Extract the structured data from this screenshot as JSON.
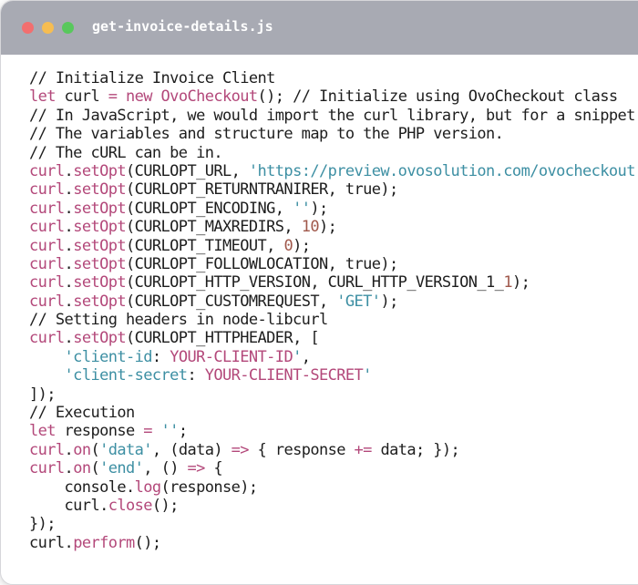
{
  "window": {
    "title": "get-invoice-details.js"
  },
  "colors": {
    "titlebar": "#a8aab3",
    "close_dot": "#f26f6f",
    "minimize_dot": "#f6bd52",
    "maximize_dot": "#58c85c",
    "default_text": "#1d1d1d",
    "keyword": "#b3487a",
    "member": "#b3487a",
    "string": "#3d8fa3",
    "number": "#a0584b",
    "comment": "#1d1d1d"
  },
  "code": {
    "lines": [
      [
        {
          "t": "// Initialize Invoice Client",
          "k": "default"
        }
      ],
      [
        {
          "t": "let",
          "k": "keyword"
        },
        {
          "t": " curl ",
          "k": "default"
        },
        {
          "t": "=",
          "k": "keyword"
        },
        {
          "t": " ",
          "k": "default"
        },
        {
          "t": "new",
          "k": "keyword"
        },
        {
          "t": " ",
          "k": "default"
        },
        {
          "t": "OvoCheckout",
          "k": "member"
        },
        {
          "t": "(); // Initialize using OvoCheckout class",
          "k": "default"
        }
      ],
      [
        {
          "t": "// In JavaScript, we would import the curl library, but for a snippet",
          "k": "default"
        }
      ],
      [
        {
          "t": "// The variables and structure map to the PHP version.",
          "k": "default"
        }
      ],
      [
        {
          "t": "// The cURL can be in.",
          "k": "default"
        }
      ],
      [
        {
          "t": "curl",
          "k": "member"
        },
        {
          "t": ".",
          "k": "default"
        },
        {
          "t": "setOpt",
          "k": "member"
        },
        {
          "t": "(CURLOPT_URL, ",
          "k": "default"
        },
        {
          "t": "'https://preview.ovosolution.com/ovocheckout'",
          "k": "string"
        }
      ],
      [
        {
          "t": "curl",
          "k": "member"
        },
        {
          "t": ".",
          "k": "default"
        },
        {
          "t": "setOpt",
          "k": "member"
        },
        {
          "t": "(CURLOPT_RETURNTRANIRER, true);",
          "k": "default"
        }
      ],
      [
        {
          "t": "curl",
          "k": "member"
        },
        {
          "t": ".",
          "k": "default"
        },
        {
          "t": "setOpt",
          "k": "member"
        },
        {
          "t": "(CURLOPT_ENCODING, ",
          "k": "default"
        },
        {
          "t": "''",
          "k": "string"
        },
        {
          "t": ");",
          "k": "default"
        }
      ],
      [
        {
          "t": "curl",
          "k": "member"
        },
        {
          "t": ".",
          "k": "default"
        },
        {
          "t": "setOpt",
          "k": "member"
        },
        {
          "t": "(CURLOPT_MAXREDIRS, ",
          "k": "default"
        },
        {
          "t": "10",
          "k": "number"
        },
        {
          "t": ");",
          "k": "default"
        }
      ],
      [
        {
          "t": "curl",
          "k": "member"
        },
        {
          "t": ".",
          "k": "default"
        },
        {
          "t": "setOpt",
          "k": "member"
        },
        {
          "t": "(CURLOPT_TIMEOUT, ",
          "k": "default"
        },
        {
          "t": "0",
          "k": "number"
        },
        {
          "t": ");",
          "k": "default"
        }
      ],
      [
        {
          "t": "curl",
          "k": "member"
        },
        {
          "t": ".",
          "k": "default"
        },
        {
          "t": "setOpt",
          "k": "member"
        },
        {
          "t": "(CURLOPT_FOLLOWLOCATION, true);",
          "k": "default"
        }
      ],
      [
        {
          "t": "curl",
          "k": "member"
        },
        {
          "t": ".",
          "k": "default"
        },
        {
          "t": "setOpt",
          "k": "member"
        },
        {
          "t": "(CURLOPT_HTTP_VERSION, CURL_HTTP_VERSION_1_",
          "k": "default"
        },
        {
          "t": "1",
          "k": "number"
        },
        {
          "t": ");",
          "k": "default"
        }
      ],
      [
        {
          "t": "curl",
          "k": "member"
        },
        {
          "t": ".",
          "k": "default"
        },
        {
          "t": "setOpt",
          "k": "member"
        },
        {
          "t": "(CURLOPT_CUSTOMREQUEST, ",
          "k": "default"
        },
        {
          "t": "'GET'",
          "k": "string"
        },
        {
          "t": ");",
          "k": "default"
        }
      ],
      [
        {
          "t": "// Setting headers in node-libcurl",
          "k": "default"
        }
      ],
      [
        {
          "t": "curl",
          "k": "member"
        },
        {
          "t": ".",
          "k": "default"
        },
        {
          "t": "setOpt",
          "k": "member"
        },
        {
          "t": "(CURLOPT_HTTPHEADER, [",
          "k": "default"
        }
      ],
      [
        {
          "t": "    ",
          "k": "default"
        },
        {
          "t": "'client-id",
          "k": "string"
        },
        {
          "t": ": ",
          "k": "default"
        },
        {
          "t": "YOUR-CLIENT-ID",
          "k": "member"
        },
        {
          "t": "'",
          "k": "string"
        },
        {
          "t": ",",
          "k": "default"
        }
      ],
      [
        {
          "t": "    ",
          "k": "default"
        },
        {
          "t": "'client-secret",
          "k": "string"
        },
        {
          "t": ": ",
          "k": "default"
        },
        {
          "t": "YOUR-CLIENT-SECRET",
          "k": "member"
        },
        {
          "t": "'",
          "k": "string"
        }
      ],
      [
        {
          "t": "]);",
          "k": "default"
        }
      ],
      [
        {
          "t": "// Execution",
          "k": "default"
        }
      ],
      [
        {
          "t": "let",
          "k": "keyword"
        },
        {
          "t": " response ",
          "k": "default"
        },
        {
          "t": "=",
          "k": "keyword"
        },
        {
          "t": " ",
          "k": "default"
        },
        {
          "t": "''",
          "k": "string"
        },
        {
          "t": ";",
          "k": "default"
        }
      ],
      [
        {
          "t": "curl",
          "k": "member"
        },
        {
          "t": ".",
          "k": "default"
        },
        {
          "t": "on",
          "k": "member"
        },
        {
          "t": "(",
          "k": "default"
        },
        {
          "t": "'data'",
          "k": "string"
        },
        {
          "t": ", (data) ",
          "k": "default"
        },
        {
          "t": "=>",
          "k": "keyword"
        },
        {
          "t": " { response ",
          "k": "default"
        },
        {
          "t": "+=",
          "k": "keyword"
        },
        {
          "t": " data; });",
          "k": "default"
        }
      ],
      [
        {
          "t": "curl",
          "k": "member"
        },
        {
          "t": ".",
          "k": "default"
        },
        {
          "t": "on",
          "k": "member"
        },
        {
          "t": "(",
          "k": "default"
        },
        {
          "t": "'end'",
          "k": "string"
        },
        {
          "t": ", () ",
          "k": "default"
        },
        {
          "t": "=>",
          "k": "keyword"
        },
        {
          "t": " {",
          "k": "default"
        }
      ],
      [
        {
          "t": "    console.",
          "k": "default"
        },
        {
          "t": "log",
          "k": "member"
        },
        {
          "t": "(response);",
          "k": "default"
        }
      ],
      [
        {
          "t": "    curl.",
          "k": "default"
        },
        {
          "t": "close",
          "k": "member"
        },
        {
          "t": "();",
          "k": "default"
        }
      ],
      [
        {
          "t": "});",
          "k": "default"
        }
      ],
      [
        {
          "t": "curl.",
          "k": "default"
        },
        {
          "t": "perform",
          "k": "member"
        },
        {
          "t": "();",
          "k": "default"
        }
      ]
    ]
  }
}
